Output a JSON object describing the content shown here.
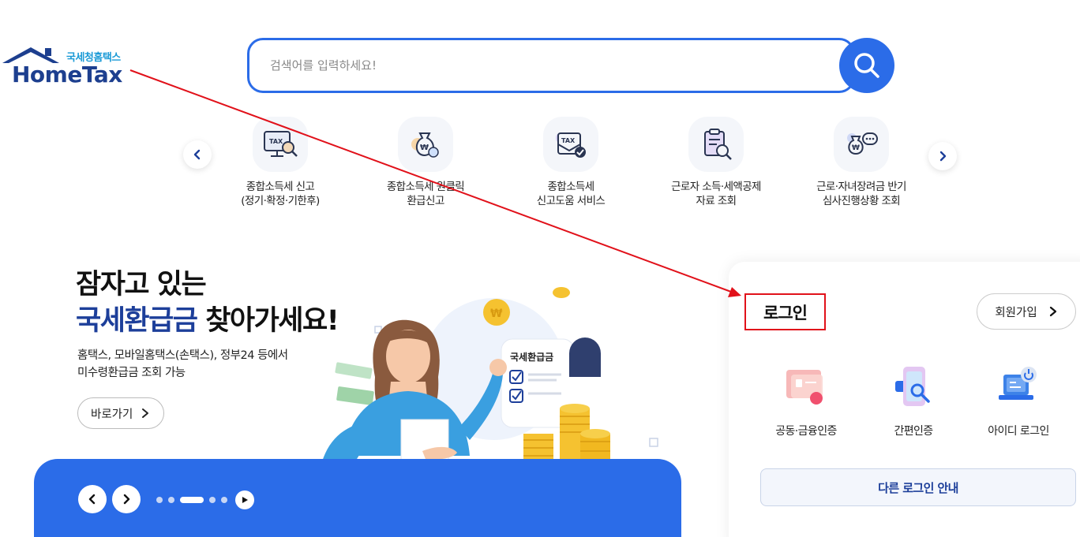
{
  "logo": {
    "sub": "국세청홈택스",
    "main": "HomeTax"
  },
  "search": {
    "placeholder": "검색어를 입력하세요!"
  },
  "icons": {
    "search": "search-icon",
    "prev": "chevron-left-icon",
    "next": "chevron-right-icon"
  },
  "quick_services": [
    {
      "line1": "종합소득세 신고",
      "line2": "(정기·확정·기한후)",
      "icon": "tax-monitor-icon"
    },
    {
      "line1": "종합소득세 원클릭",
      "line2": "환급신고",
      "icon": "money-bag-icon"
    },
    {
      "line1": "종합소득세",
      "line2": "신고도움 서비스",
      "icon": "tax-envelope-icon"
    },
    {
      "line1": "근로자 소득·세액공제",
      "line2": "자료 조회",
      "icon": "clipboard-search-icon"
    },
    {
      "line1": "근로·자녀장려금 반기",
      "line2": "심사진행상황 조회",
      "icon": "money-chat-icon"
    }
  ],
  "banner": {
    "title_line1": "잠자고 있는",
    "title_highlight": "국세환급금",
    "title_rest": " 찾아가세요!",
    "desc_line1": "홈택스, 모바일홈택스(손택스), 정부24 등에서",
    "desc_line2": "미수령환급금 조회 가능",
    "link_label": "바로가기",
    "card_label": "국세환급금",
    "slides_total": 5,
    "slide_active": 3
  },
  "login": {
    "title": "로그인",
    "signup_label": "회원가입",
    "options": [
      {
        "label": "공동·금융인증",
        "icon": "certificate-card-icon"
      },
      {
        "label": "간편인증",
        "icon": "phone-search-icon"
      },
      {
        "label": "아이디 로그인",
        "icon": "laptop-power-icon"
      }
    ],
    "other_login_label": "다른 로그인 안내"
  },
  "colors": {
    "primary": "#2b6ce8",
    "navy": "#1d3f9a",
    "annotation": "#e1111a"
  }
}
